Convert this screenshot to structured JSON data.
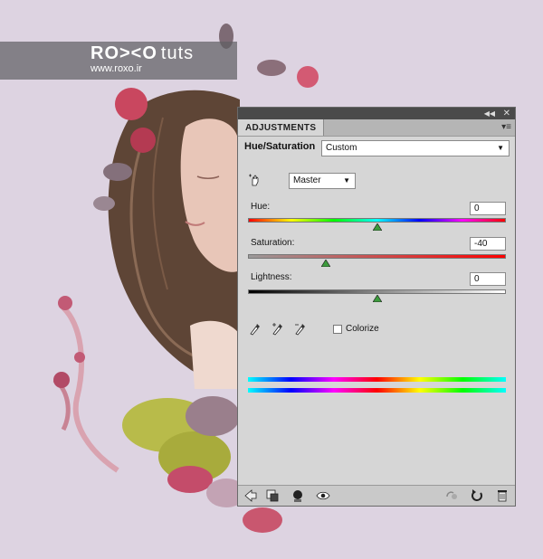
{
  "watermark": {
    "logo": "RO><O",
    "logo_suffix": "tuts",
    "url": "www.roxo.ir"
  },
  "panel": {
    "tab_label": "ADJUSTMENTS",
    "title": "Hue/Saturation",
    "preset_value": "Custom",
    "channel_value": "Master",
    "hue": {
      "label": "Hue:",
      "value": "0",
      "level": 0
    },
    "saturation": {
      "label": "Saturation:",
      "value": "-40",
      "level": -40
    },
    "lightness": {
      "label": "Lightness:",
      "value": "0",
      "level": 0
    },
    "colorize_label": "Colorize",
    "colorize_checked": false,
    "accent_thumb_color": "#3c9b3c"
  },
  "icons": {
    "titlebar": [
      "collapse-icon",
      "close-icon"
    ],
    "tools": [
      "targeted-adjust-hand-icon",
      "eyedropper-icon",
      "eyedropper-plus-icon",
      "eyedropper-minus-icon"
    ],
    "bottom": [
      "back-arrow-icon",
      "clip-to-layer-icon",
      "mask-visibility-icon",
      "eye-icon",
      "previous-state-icon",
      "reset-icon",
      "trash-icon"
    ]
  }
}
